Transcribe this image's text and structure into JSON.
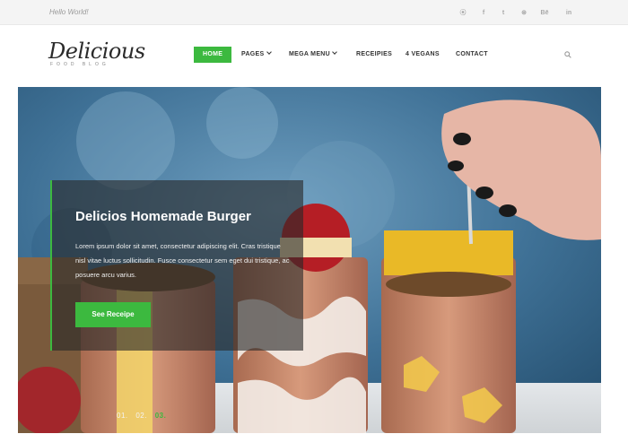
{
  "topbar": {
    "greeting": "Hello World!",
    "social": [
      {
        "icon": "pinterest-icon",
        "glyph": "⦿"
      },
      {
        "icon": "facebook-icon",
        "glyph": "f"
      },
      {
        "icon": "twitter-icon",
        "glyph": "t"
      },
      {
        "icon": "dribbble-icon",
        "glyph": "⊛"
      },
      {
        "icon": "behance-icon",
        "glyph": "Bē"
      },
      {
        "icon": "linkedin-icon",
        "glyph": "in"
      }
    ]
  },
  "header": {
    "logo_title": "Delicious",
    "logo_subtitle": "FOOD BLOG",
    "nav": [
      {
        "label": "HOME",
        "active": true,
        "dropdown": false
      },
      {
        "label": "PAGES",
        "active": false,
        "dropdown": true
      },
      {
        "label": "MEGA MENU",
        "active": false,
        "dropdown": true
      },
      {
        "label": "RECEIPIES",
        "active": false,
        "dropdown": false
      },
      {
        "label": "4 VEGANS",
        "active": false,
        "dropdown": false
      },
      {
        "label": "CONTACT",
        "active": false,
        "dropdown": false
      }
    ]
  },
  "hero": {
    "title": "Delicios Homemade Burger",
    "text": "Lorem ipsum dolor sit amet, consectetur adipiscing elit. Cras tristique nisl vitae luctus sollicitudin. Fusce consectetur sem eget dui tristique, ac posuere arcu varius.",
    "button_label": "See Receipe",
    "slides": [
      "01.",
      "02.",
      "03."
    ],
    "active_slide": 3
  },
  "colors": {
    "accent": "#3cb93f",
    "topbar_bg": "#f4f4f4",
    "hero_bg": "#4e7ea0"
  }
}
